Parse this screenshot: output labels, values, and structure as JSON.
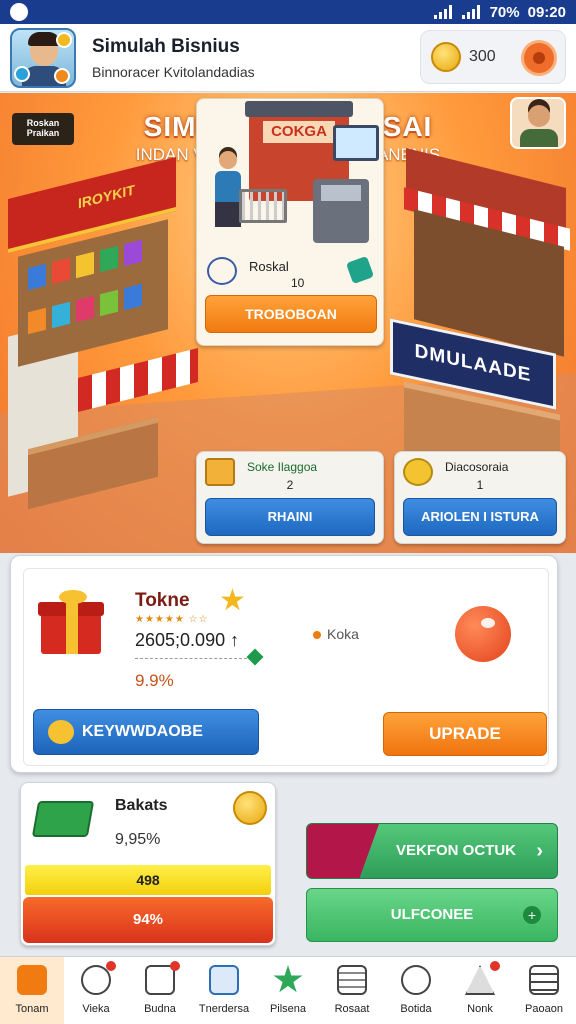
{
  "status_bar": {
    "battery": "70%",
    "time": "09:20"
  },
  "header": {
    "title": "Simulah Bisnius",
    "subtitle": "Binnoracer Kvitolandadias",
    "coins": "300"
  },
  "banner": {
    "tag": "Roskan Praikan",
    "title": "SIMULIASI BISINSAI",
    "subtitle": "INDAN VITUAL DERAKNAI EIDANENIS"
  },
  "left_shop": {
    "sign": "IROYKIT"
  },
  "center_card": {
    "store_sign": "COKGA",
    "label": "Roskal",
    "count": "10",
    "button": "TROBOBOAN"
  },
  "right_shop": {
    "sign": "DMULAADE"
  },
  "mini_cards": [
    {
      "title": "Soke Ilaggoa",
      "count": "2",
      "button": "RHAINI"
    },
    {
      "title": "Diacosoraia",
      "count": "1",
      "button": "ARIOLEN I ISTURA"
    }
  ],
  "product": {
    "title": "Tokne",
    "rating": "★★★★★ ☆☆",
    "price": "2605;0.090 ↑",
    "percent": "9.9%",
    "tag": "Koka",
    "primary_button": "KEYWWDAOBE",
    "secondary_button": "UPRADE"
  },
  "stats": {
    "title": "Bakats",
    "percent": "9,95%",
    "bar_top": "498",
    "bar_bottom": "94%"
  },
  "actions": {
    "top_button": "VEKFON OCTUK",
    "bottom_button": "ULFCONEE"
  },
  "nav": [
    {
      "label": "Tonam",
      "active": true
    },
    {
      "label": "Vieka"
    },
    {
      "label": "Budna"
    },
    {
      "label": "Tnerdersa"
    },
    {
      "label": "Pilsena"
    },
    {
      "label": "Rosaat"
    },
    {
      "label": "Botida"
    },
    {
      "label": "Nonk"
    },
    {
      "label": "Paoaon"
    }
  ],
  "colors": {
    "status_bar": "#1a3c8f",
    "accent_orange": "#f07b10",
    "accent_blue": "#1f68c0",
    "accent_green": "#2f9e58"
  }
}
